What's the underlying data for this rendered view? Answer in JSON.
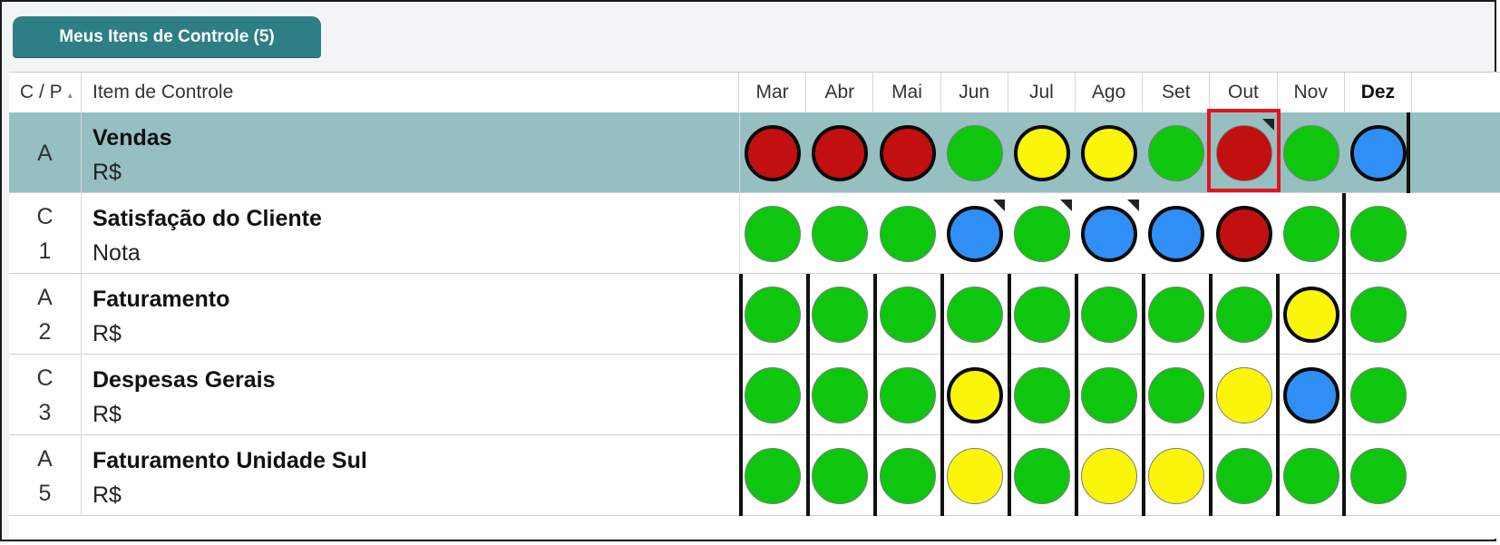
{
  "panel": {
    "title": "Meus Itens de Controle (5)"
  },
  "header": {
    "cp": "C / P",
    "item": "Item de Controle",
    "months": [
      "Mar",
      "Abr",
      "Mai",
      "Jun",
      "Jul",
      "Ago",
      "Set",
      "Out",
      "Nov",
      "Dez"
    ],
    "bold_month": "Dez"
  },
  "colors": {
    "red": "#c20f0f",
    "green": "#0fc60f",
    "yellow": "#fbf50a",
    "blue": "#2f8ff7",
    "selected_row": "#96bfc2",
    "tab": "#2e7f85"
  },
  "rows": [
    {
      "cp_top": "A",
      "cp_bottom": "",
      "name": "Vendas",
      "unit": "R$",
      "selected": true,
      "cells": [
        [
          "red",
          1,
          0
        ],
        [
          "red",
          1,
          0
        ],
        [
          "red",
          1,
          0
        ],
        [
          "green",
          0,
          0
        ],
        [
          "yellow",
          1,
          0
        ],
        [
          "yellow",
          1,
          0
        ],
        [
          "green",
          0,
          0
        ],
        [
          "red",
          0,
          1
        ],
        [
          "green",
          0,
          0
        ],
        [
          "blue",
          1,
          0
        ]
      ]
    },
    {
      "cp_top": "C",
      "cp_bottom": "1",
      "name": "Satisfação do Cliente",
      "unit": "Nota",
      "selected": false,
      "cells": [
        [
          "green",
          0,
          0
        ],
        [
          "green",
          0,
          0
        ],
        [
          "green",
          0,
          0
        ],
        [
          "blue",
          1,
          1
        ],
        [
          "green",
          0,
          1
        ],
        [
          "blue",
          1,
          1
        ],
        [
          "blue",
          1,
          0
        ],
        [
          "red",
          1,
          0
        ],
        [
          "green",
          0,
          0
        ],
        [
          "green",
          0,
          0
        ]
      ]
    },
    {
      "cp_top": "A",
      "cp_bottom": "2",
      "name": "Faturamento",
      "unit": "R$",
      "selected": false,
      "cells": [
        [
          "green",
          0,
          0
        ],
        [
          "green",
          0,
          0
        ],
        [
          "green",
          0,
          0
        ],
        [
          "green",
          0,
          0
        ],
        [
          "green",
          0,
          0
        ],
        [
          "green",
          0,
          0
        ],
        [
          "green",
          0,
          0
        ],
        [
          "green",
          0,
          0
        ],
        [
          "yellow",
          1,
          0
        ],
        [
          "green",
          0,
          0
        ]
      ]
    },
    {
      "cp_top": "C",
      "cp_bottom": "3",
      "name": "Despesas Gerais",
      "unit": "R$",
      "selected": false,
      "cells": [
        [
          "green",
          0,
          0
        ],
        [
          "green",
          0,
          0
        ],
        [
          "green",
          0,
          0
        ],
        [
          "yellow",
          1,
          0
        ],
        [
          "green",
          0,
          0
        ],
        [
          "green",
          0,
          0
        ],
        [
          "green",
          0,
          0
        ],
        [
          "yellow",
          0,
          0
        ],
        [
          "blue",
          1,
          0
        ],
        [
          "green",
          0,
          0
        ]
      ]
    },
    {
      "cp_top": "A",
      "cp_bottom": "5",
      "name": "Faturamento Unidade Sul",
      "unit": "R$",
      "selected": false,
      "cells": [
        [
          "green",
          0,
          0
        ],
        [
          "green",
          0,
          0
        ],
        [
          "green",
          0,
          0
        ],
        [
          "yellow",
          0,
          0
        ],
        [
          "green",
          0,
          0
        ],
        [
          "yellow",
          0,
          0
        ],
        [
          "yellow",
          0,
          0
        ],
        [
          "green",
          0,
          0
        ],
        [
          "green",
          0,
          0
        ],
        [
          "green",
          0,
          0
        ]
      ]
    }
  ]
}
